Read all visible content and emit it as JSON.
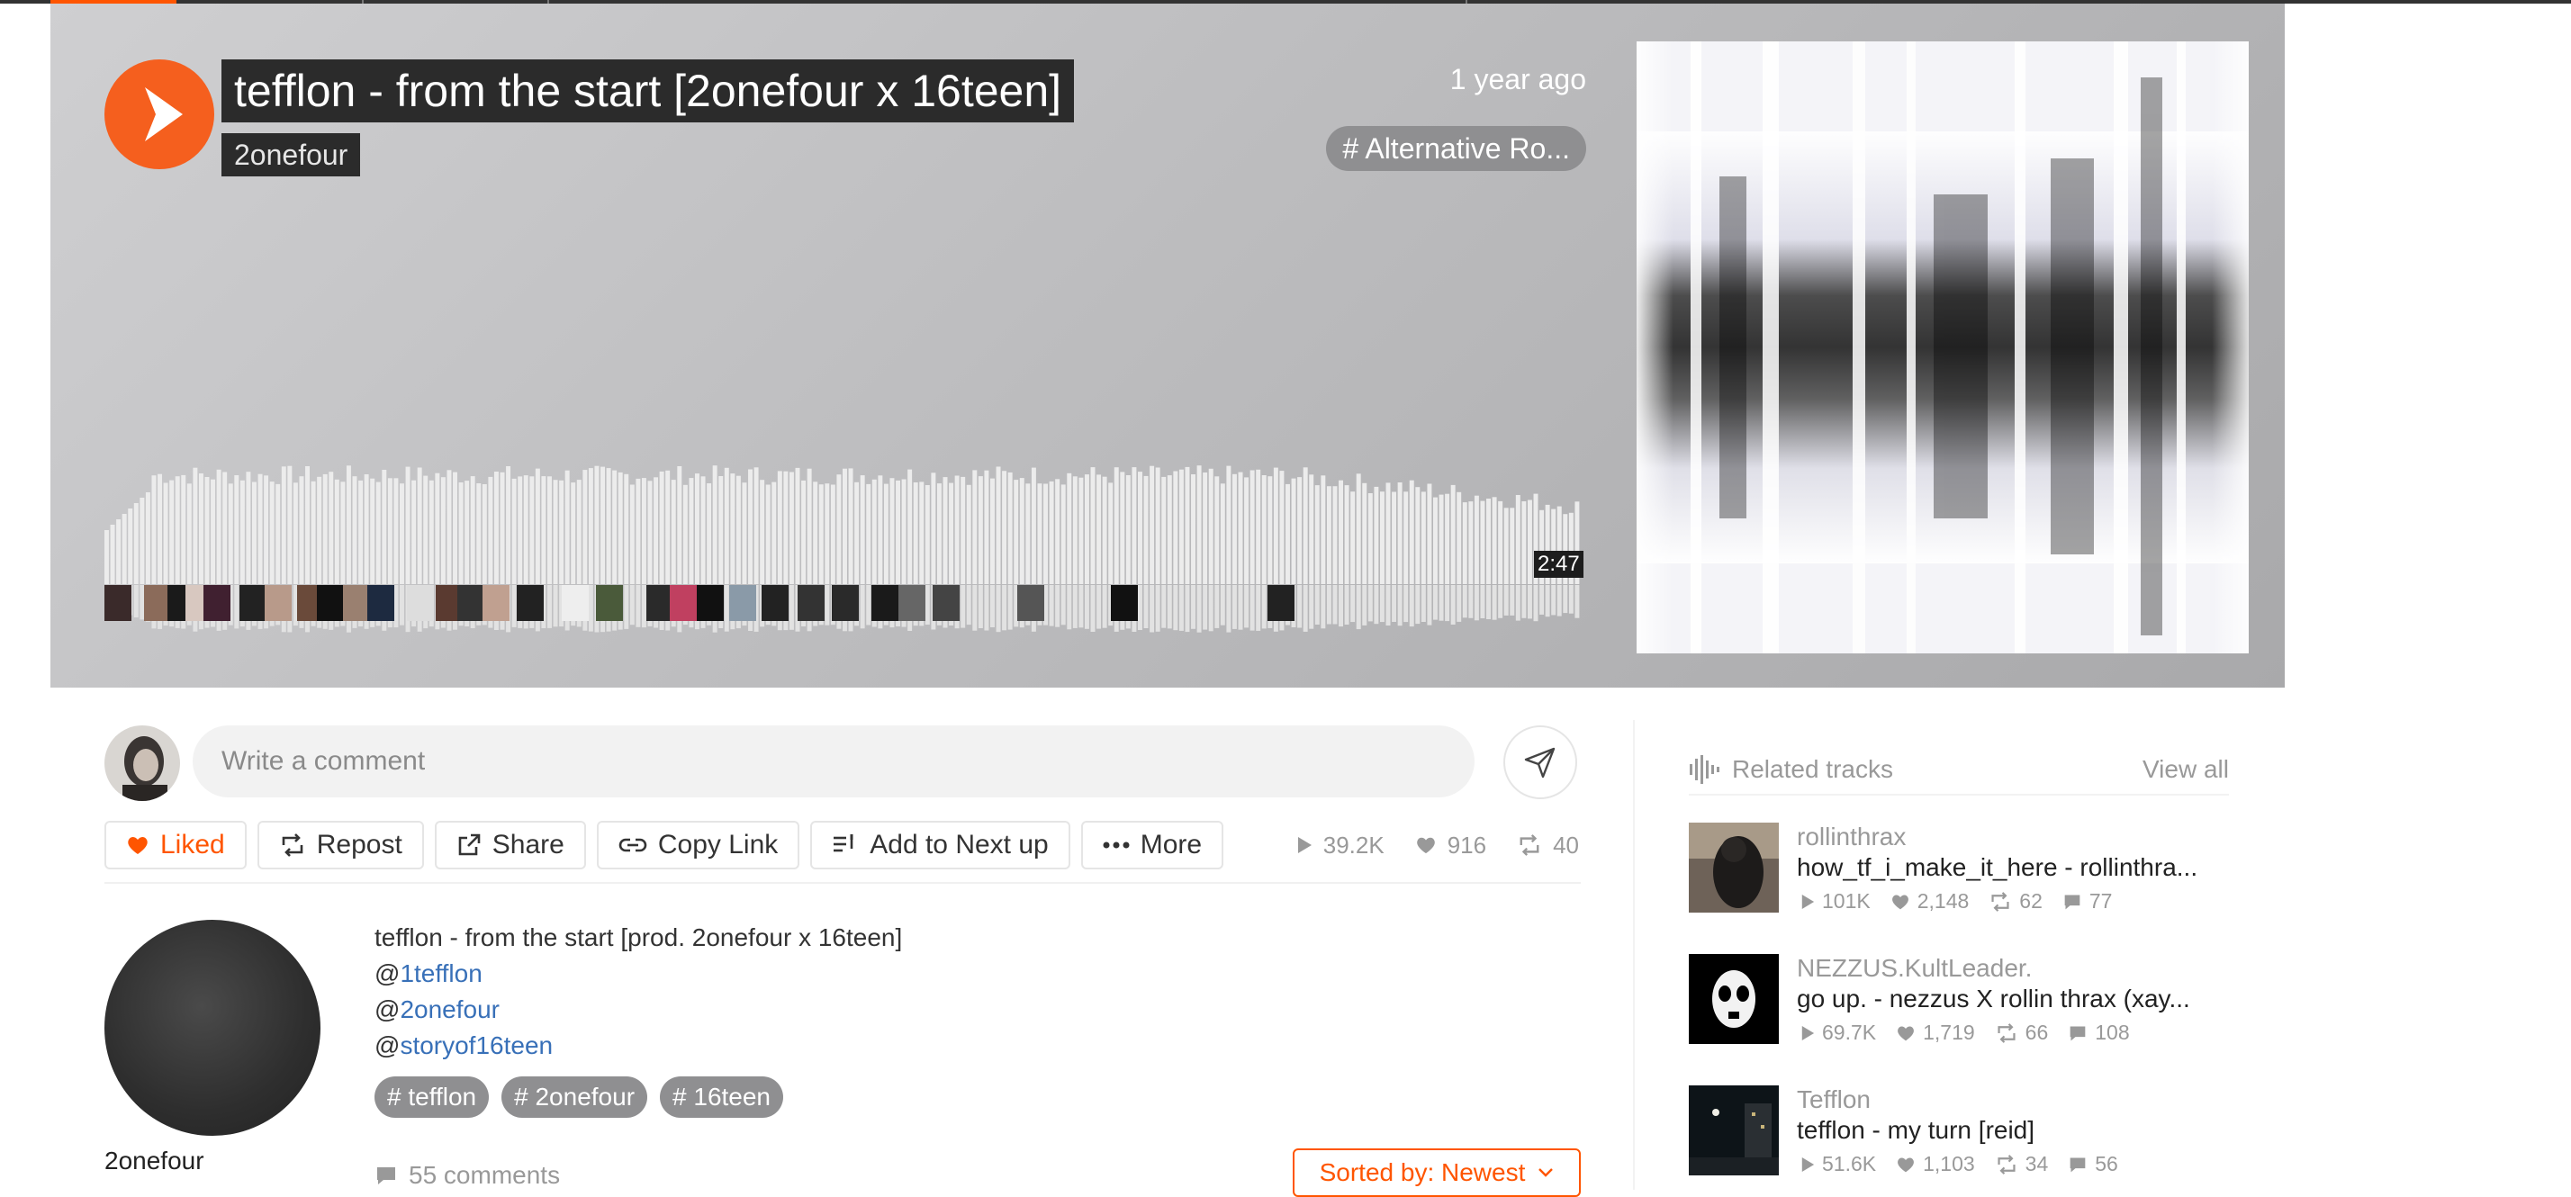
{
  "track": {
    "title": "tefflon - from the start [2onefour x 16teen]",
    "artist": "2onefour",
    "time_ago": "1 year ago",
    "genre": "# Alternative Ro...",
    "duration": "2:47"
  },
  "comment": {
    "placeholder": "Write a comment"
  },
  "actions": {
    "liked": "Liked",
    "repost": "Repost",
    "share": "Share",
    "copy_link": "Copy Link",
    "add_next": "Add to Next up",
    "more": "More"
  },
  "stats": {
    "plays": "39.2K",
    "likes": "916",
    "reposts": "40"
  },
  "uploader": {
    "name": "2onefour"
  },
  "description": {
    "line1": "tefflon - from the start [prod. 2onefour x 16teen]",
    "mentions": [
      {
        "at": "@",
        "handle": "1tefflon"
      },
      {
        "at": "@",
        "handle": "2onefour"
      },
      {
        "at": "@",
        "handle": "storyof16teen"
      }
    ]
  },
  "tags": [
    "# tefflon",
    "# 2onefour",
    "# 16teen"
  ],
  "comments": {
    "count": "55 comments",
    "sort_label": "Sorted by: Newest"
  },
  "related": {
    "title": "Related tracks",
    "view_all": "View all",
    "tracks": [
      {
        "user": "rollinthrax",
        "title": "how_tf_i_make_it_here - rollinthra...",
        "plays": "101K",
        "likes": "2,148",
        "reposts": "62",
        "comments": "77"
      },
      {
        "user": "NEZZUS.KultLeader.",
        "title": "go up. - nezzus X rollin thrax (xay...",
        "plays": "69.7K",
        "likes": "1,719",
        "reposts": "66",
        "comments": "108"
      },
      {
        "user": "Tefflon",
        "title": "tefflon - my turn [reid]",
        "plays": "51.6K",
        "likes": "1,103",
        "reposts": "34",
        "comments": "56"
      }
    ]
  },
  "colors": {
    "accent": "#ff5500",
    "link": "#3870b8"
  }
}
